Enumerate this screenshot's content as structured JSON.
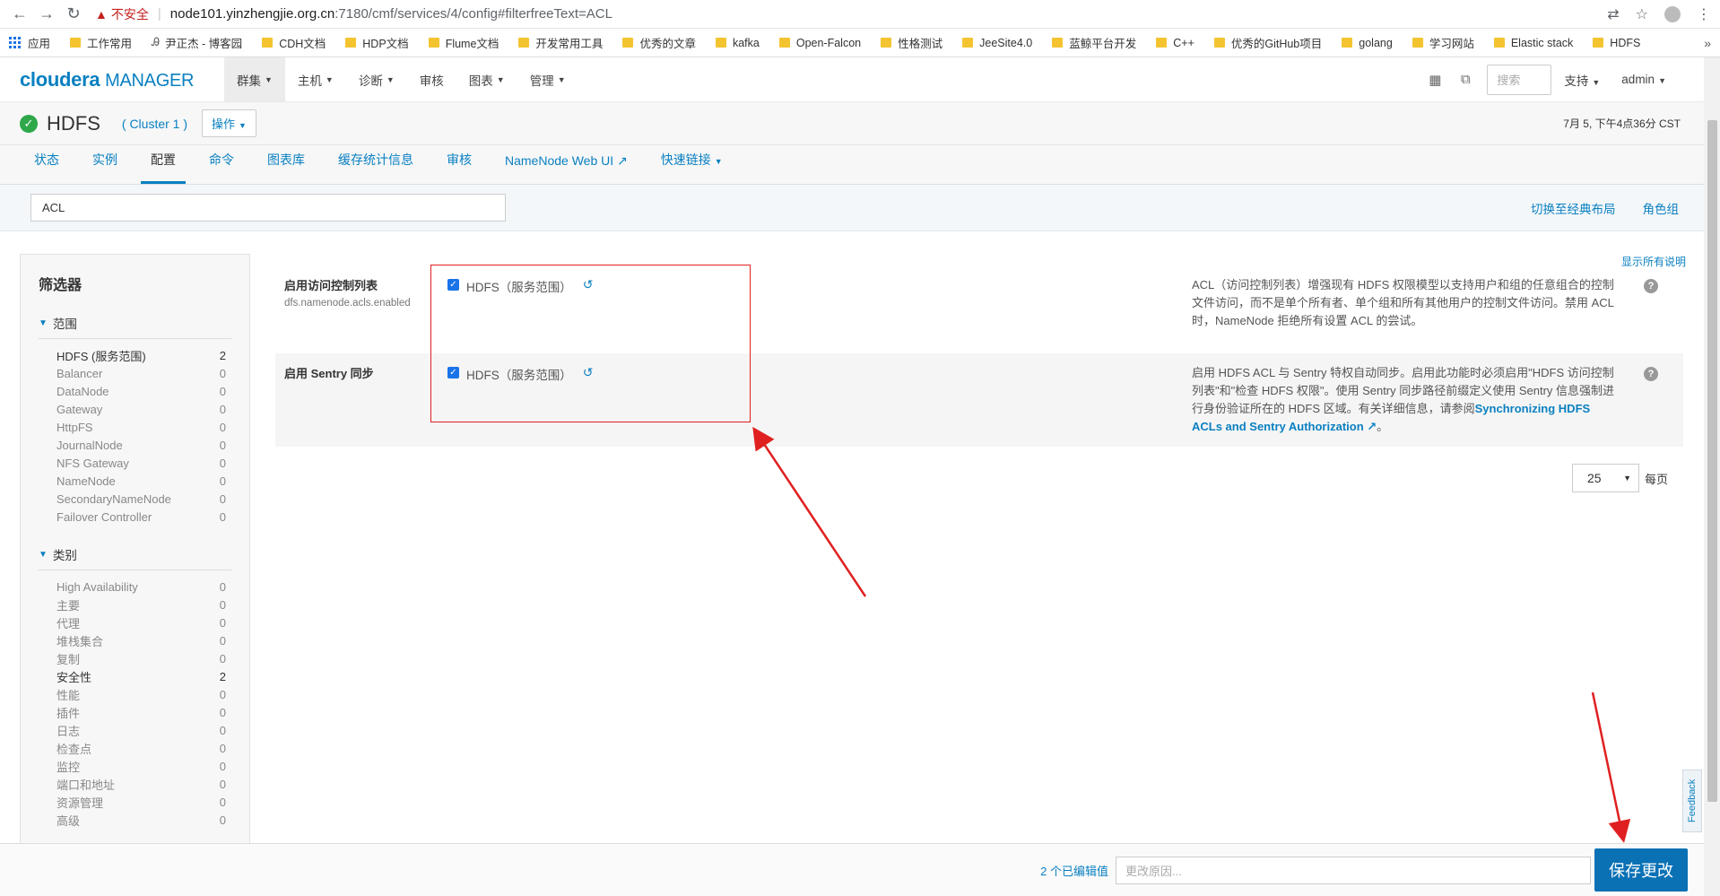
{
  "browser": {
    "insecure_label": "不安全",
    "url_host": "node101.yinzhengjie.org.cn",
    "url_rest": ":7180/cmf/services/4/config#filterfreeText=ACL",
    "bookmarks": [
      "应用",
      "工作常用",
      "尹正杰 - 博客园",
      "CDH文档",
      "HDP文档",
      "Flume文档",
      "开发常用工具",
      "优秀的文章",
      "kafka",
      "Open-Falcon",
      "性格测试",
      "JeeSite4.0",
      "蓝鲸平台开发",
      "C++",
      "优秀的GitHub项目",
      "golang",
      "学习网站",
      "Elastic stack",
      "HDFS"
    ],
    "bookmarks_more": "»"
  },
  "header": {
    "logo_bold": "cloudera",
    "logo_rest": "MANAGER",
    "nav": [
      "群集",
      "主机",
      "诊断",
      "审核",
      "图表",
      "管理"
    ],
    "search_placeholder": "搜索",
    "support": "支持",
    "user": "admin"
  },
  "service": {
    "name": "HDFS",
    "cluster": "( Cluster 1 )",
    "actions": "操作",
    "time": "7月 5, 下午4点36分 CST"
  },
  "tabs": [
    "状态",
    "实例",
    "配置",
    "命令",
    "图表库",
    "缓存统计信息",
    "审核",
    "NameNode Web UI",
    "快速链接"
  ],
  "filter": {
    "value": "ACL",
    "switch_layout": "切换至经典布局",
    "role_groups": "角色组"
  },
  "sidebar": {
    "title": "筛选器",
    "scope_title": "范围",
    "scope": [
      {
        "label": "HDFS (服务范围)",
        "count": "2"
      },
      {
        "label": "Balancer",
        "count": "0"
      },
      {
        "label": "DataNode",
        "count": "0"
      },
      {
        "label": "Gateway",
        "count": "0"
      },
      {
        "label": "HttpFS",
        "count": "0"
      },
      {
        "label": "JournalNode",
        "count": "0"
      },
      {
        "label": "NFS Gateway",
        "count": "0"
      },
      {
        "label": "NameNode",
        "count": "0"
      },
      {
        "label": "SecondaryNameNode",
        "count": "0"
      },
      {
        "label": "Failover Controller",
        "count": "0"
      }
    ],
    "category_title": "类别",
    "categories": [
      {
        "label": "High Availability",
        "count": "0"
      },
      {
        "label": "主要",
        "count": "0"
      },
      {
        "label": "代理",
        "count": "0"
      },
      {
        "label": "堆栈集合",
        "count": "0"
      },
      {
        "label": "复制",
        "count": "0"
      },
      {
        "label": "安全性",
        "count": "2"
      },
      {
        "label": "性能",
        "count": "0"
      },
      {
        "label": "插件",
        "count": "0"
      },
      {
        "label": "日志",
        "count": "0"
      },
      {
        "label": "检查点",
        "count": "0"
      },
      {
        "label": "监控",
        "count": "0"
      },
      {
        "label": "端口和地址",
        "count": "0"
      },
      {
        "label": "资源管理",
        "count": "0"
      },
      {
        "label": "高级",
        "count": "0"
      }
    ]
  },
  "show_all_desc": "显示所有说明",
  "configs": [
    {
      "name": "启用访问控制列表",
      "key": "dfs.namenode.acls.enabled",
      "value": "HDFS（服务范围）",
      "desc": "ACL（访问控制列表）增强现有 HDFS 权限模型以支持用户和组的任意组合的控制文件访问，而不是单个所有者、单个组和所有其他用户的控制文件访问。禁用 ACL 时，NameNode 拒绝所有设置 ACL 的尝试。"
    },
    {
      "name": "启用 Sentry 同步",
      "key": "",
      "value": "HDFS（服务范围）",
      "desc": "启用 HDFS ACL 与 Sentry 特权自动同步。启用此功能时必须启用\"HDFS 访问控制列表\"和\"检查 HDFS 权限\"。使用 Sentry 同步路径前缀定义使用 Sentry 信息强制进行身份验证所在的 HDFS 区域。有关详细信息，请参阅",
      "link": "Synchronizing HDFS ACLs and Sentry Authorization",
      "desc_end": "。"
    }
  ],
  "pager": {
    "size": "25",
    "label": "每页"
  },
  "footer": {
    "edited": "2 个已编辑值",
    "reason_placeholder": "更改原因...",
    "save": "保存更改"
  },
  "feedback": "Feedback",
  "colors": {
    "brand": "#0a80c1",
    "save": "#0a71b5",
    "ok": "#2ea84a",
    "annotation": "#e02020"
  }
}
